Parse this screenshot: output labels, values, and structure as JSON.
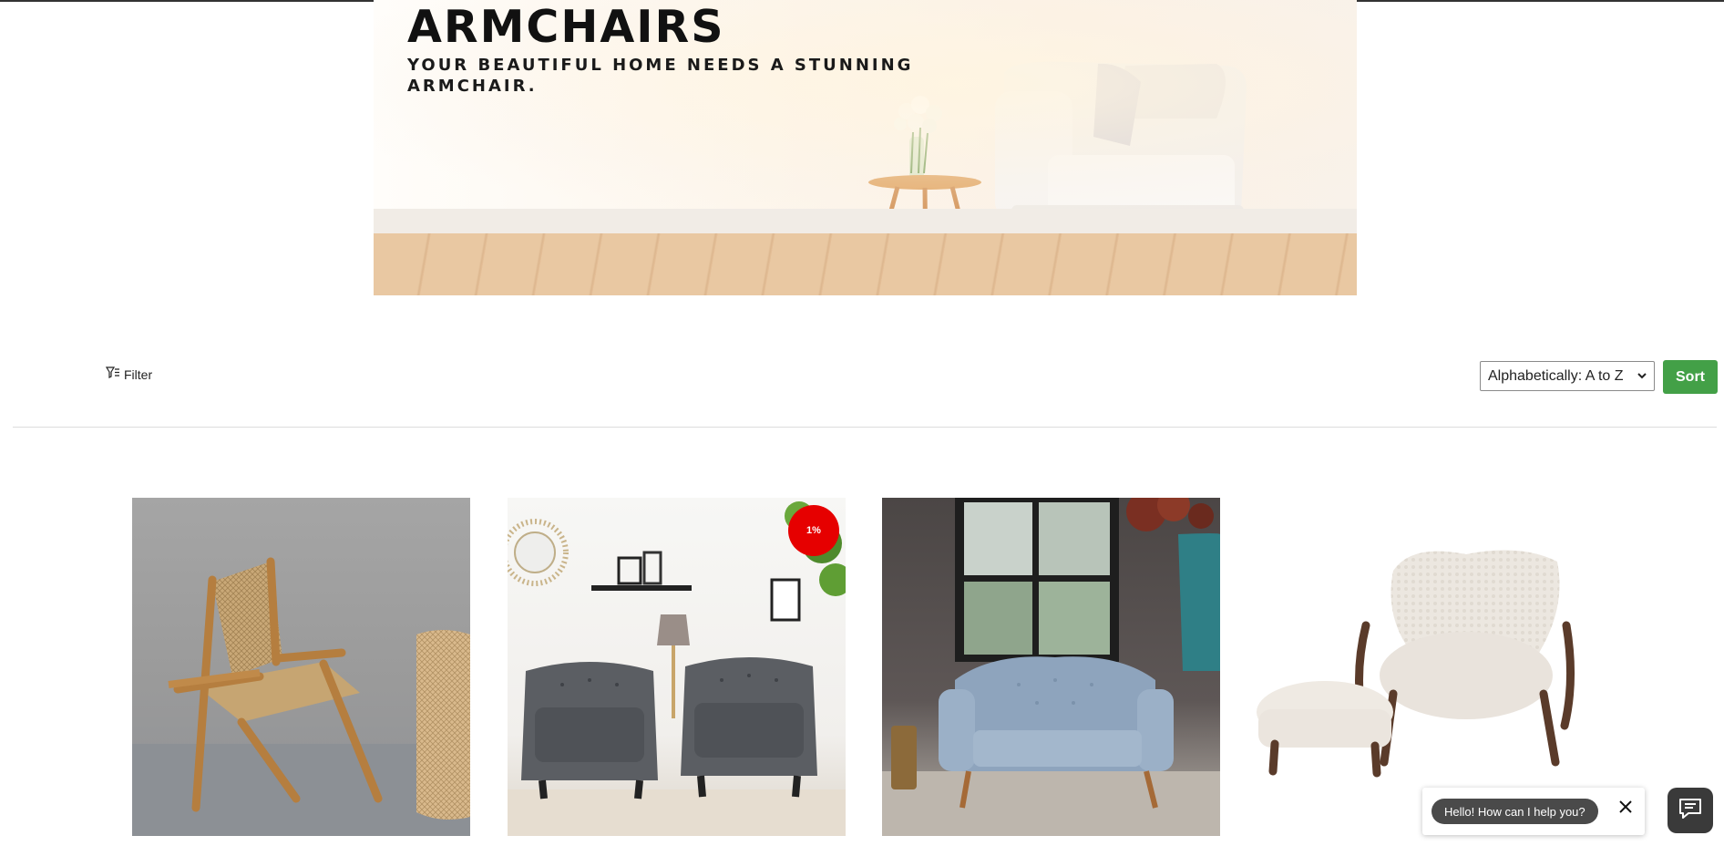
{
  "hero": {
    "title": "ARMCHAIRS",
    "subtitle": "YOUR BEAUTIFUL HOME NEEDS A STUNNING ARMCHAIR."
  },
  "toolbar": {
    "filter_label": "Filter",
    "sort_selected": "Alphabetically: A to Z",
    "sort_button_label": "Sort"
  },
  "products": [
    {
      "image_icon": "cane-armchair-image"
    },
    {
      "image_icon": "grey-tub-chairs-image",
      "badge": "1%"
    },
    {
      "image_icon": "blue-tufted-armchair-image"
    },
    {
      "image_icon": "shearling-chair-ottoman-image"
    }
  ],
  "chat": {
    "greeting": "Hello! How can I help you?"
  },
  "colors": {
    "sort_button": "#43a047",
    "sale_badge": "#e60000",
    "chat_pill": "#4a4a4a"
  }
}
